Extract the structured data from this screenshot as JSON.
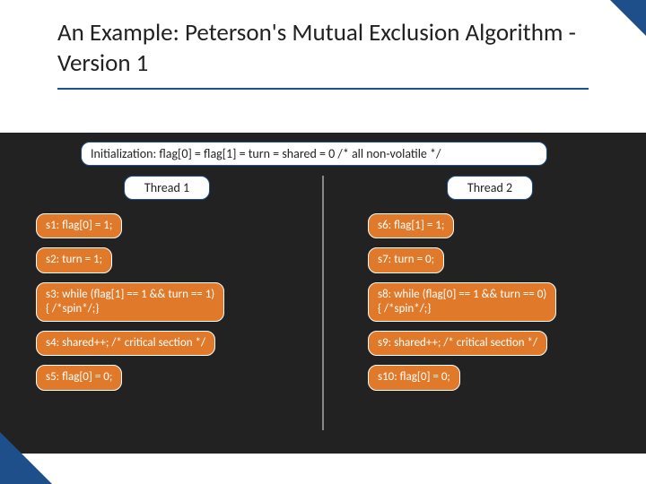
{
  "title": "An Example: Peterson's Mutual Exclusion Algorithm - Version 1",
  "init": "Initialization: flag[0] = flag[1] = turn = shared = 0 /* all non-volatile */",
  "thread1": {
    "label": "Thread 1",
    "stmts": [
      "s1: flag[0] = 1;",
      "s2: turn = 1;",
      "s3: while (flag[1] == 1 && turn == 1)\n       { /*spin*/;}",
      "s4: shared++; /* critical section */",
      "s5: flag[0] = 0;"
    ]
  },
  "thread2": {
    "label": "Thread 2",
    "stmts": [
      "s6: flag[1] = 1;",
      "s7: turn = 0;",
      "s8: while (flag[0] == 1 && turn == 0)\n       { /*spin*/;}",
      "s9: shared++; /* critical section */",
      "s10: flag[0] = 0;"
    ]
  }
}
